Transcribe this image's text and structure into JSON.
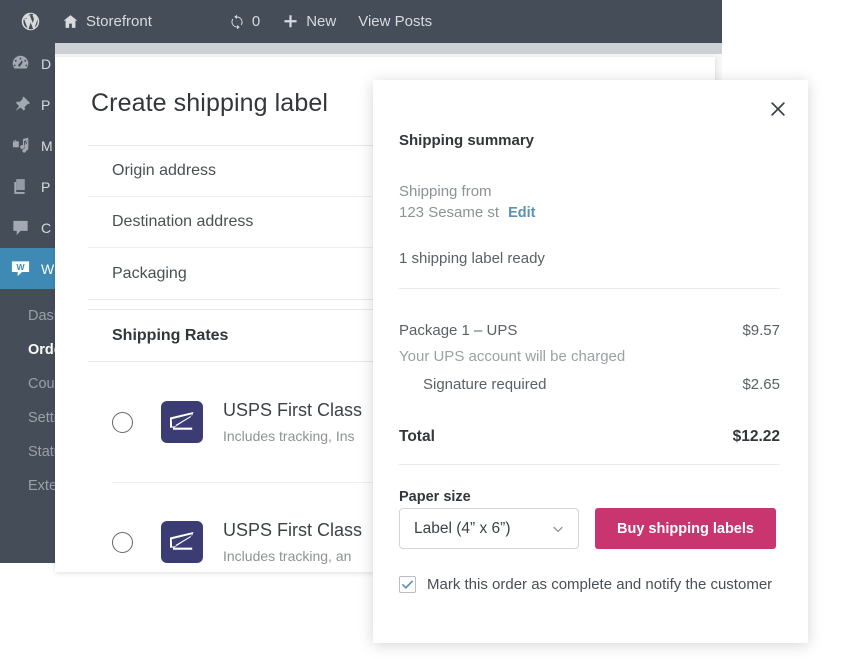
{
  "admin_bar": {
    "logo_icon": "wordpress-logo-icon",
    "site_icon": "home-icon",
    "site_name": "Storefront",
    "updates_icon": "updates-icon",
    "updates_count": "0",
    "new_icon": "plus-icon",
    "new_label": "New",
    "view_posts_label": "View Posts"
  },
  "sidebar": {
    "items": [
      {
        "label": "D",
        "icon": "dashboard-icon",
        "name": "dashboard"
      },
      {
        "label": "P",
        "icon": "pin-icon",
        "name": "posts"
      },
      {
        "label": "M",
        "icon": "media-icon",
        "name": "media"
      },
      {
        "label": "P",
        "icon": "pages-icon",
        "name": "pages"
      },
      {
        "label": "C",
        "icon": "comments-icon",
        "name": "comments"
      },
      {
        "label": "W",
        "icon": "woocommerce-icon",
        "name": "woocommerce"
      }
    ],
    "submenu": [
      {
        "label": "Dash"
      },
      {
        "label": "Orde"
      },
      {
        "label": "Coup"
      },
      {
        "label": "Setti"
      },
      {
        "label": "Statu"
      },
      {
        "label": "Exter"
      }
    ]
  },
  "label_card": {
    "title": "Create shipping label",
    "sections": [
      {
        "label": "Origin address"
      },
      {
        "label": "Destination address"
      },
      {
        "label": "Packaging"
      }
    ],
    "rates_header": "Shipping Rates",
    "rates": [
      {
        "carrier_icon": "usps-logo-icon",
        "title": "USPS First Class",
        "subtitle": "Includes tracking, Ins",
        "selected": false
      },
      {
        "carrier_icon": "usps-logo-icon",
        "title": "USPS First Class",
        "subtitle": "Includes tracking, an",
        "selected": false
      }
    ]
  },
  "modal": {
    "close_icon": "close-icon",
    "heading": "Shipping summary",
    "shipping_from_label": "Shipping from",
    "shipping_from_address": "123 Sesame st",
    "edit_link": "Edit",
    "labels_ready": "1 shipping label ready",
    "costs": {
      "package_label": "Package 1 – UPS",
      "package_amount": "$9.57",
      "package_note": "Your UPS account will be charged",
      "signature_label": "Signature required",
      "signature_amount": "$2.65",
      "total_label": "Total",
      "total_amount": "$12.22"
    },
    "paper_size_label": "Paper size",
    "paper_size_value": "Label (4” x 6”)",
    "paper_size_chevron": "chevron-down-icon",
    "buy_button_label": "Buy shipping labels",
    "complete_checkbox_checked": true,
    "complete_label": "Mark this order as complete and notify the customer"
  },
  "colors": {
    "admin_bar": "#454d58",
    "accent_blue": "#3e8ab4",
    "link_blue": "#5a92b5",
    "buy_button": "#c9356e",
    "usps_navy": "#3c3c74"
  }
}
